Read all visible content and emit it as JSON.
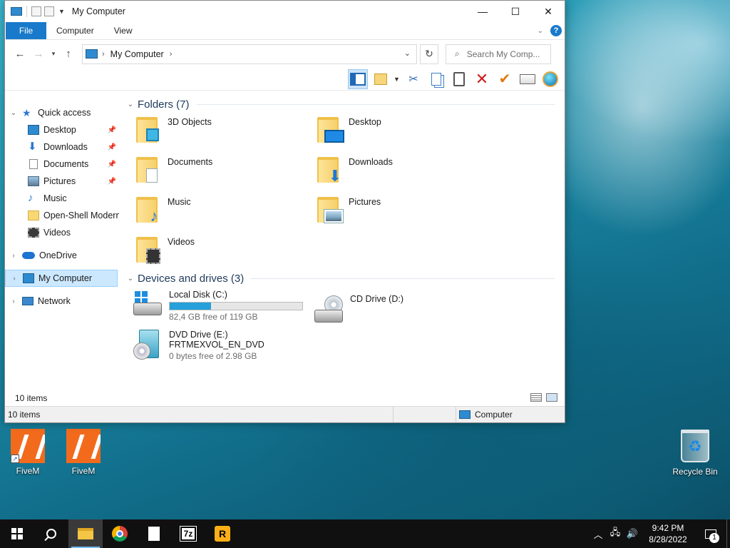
{
  "desktop": {
    "icons": [
      {
        "label": "FiveM"
      },
      {
        "label": "FiveM"
      },
      {
        "label": "Recycle Bin"
      }
    ]
  },
  "window": {
    "title": "My Computer",
    "ribbon_tabs": [
      "File",
      "Computer",
      "View"
    ],
    "address": {
      "crumb": "My Computer"
    },
    "search_placeholder": "Search My Comp...",
    "nav": {
      "quick_access": "Quick access",
      "quick_items": [
        "Desktop",
        "Downloads",
        "Documents",
        "Pictures",
        "Music",
        "Open-Shell Modern",
        "Videos"
      ],
      "onedrive": "OneDrive",
      "my_computer": "My Computer",
      "network": "Network"
    },
    "folders_header": "Folders (7)",
    "folders": [
      "3D Objects",
      "Desktop",
      "Documents",
      "Downloads",
      "Music",
      "Pictures",
      "Videos"
    ],
    "devices_header": "Devices and drives (3)",
    "drives": [
      {
        "name": "Local Disk (C:)",
        "free": "82,4 GB free of 119 GB",
        "used_fraction": 0.31
      },
      {
        "name": "CD Drive (D:)"
      },
      {
        "name": "DVD Drive (E:)",
        "label": "FRTMEXVOL_EN_DVD",
        "free": "0 bytes free of 2.98 GB"
      }
    ],
    "status_items": "10 items",
    "status_bar": {
      "items": "10 items",
      "location": "Computer"
    }
  },
  "taskbar": {
    "time": "9:42 PM",
    "date": "8/28/2022",
    "sevenzip": "7z",
    "rockstar": "R",
    "notification_count": "1"
  }
}
